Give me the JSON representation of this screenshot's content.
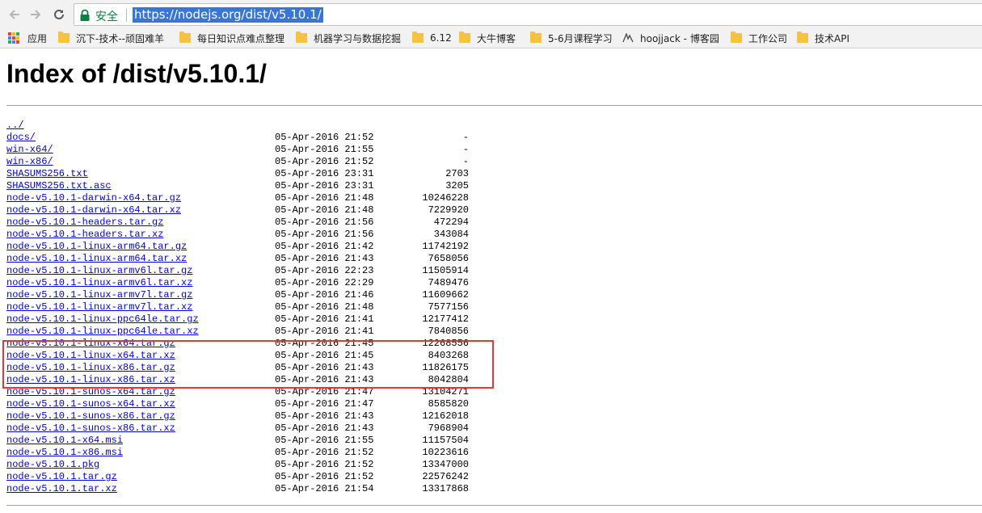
{
  "browser": {
    "secure_label": "安全",
    "url": "https://nodejs.org/dist/v5.10.1/",
    "accent": "#3875d7",
    "secure_color": "#0b8043"
  },
  "bookmarks": [
    {
      "label": "应用",
      "icon": "apps-grid-icon"
    },
    {
      "label": "沉下-技术--顽固难羊",
      "icon": "folder-icon"
    },
    {
      "label": "每日知识点难点整理",
      "icon": "folder-icon"
    },
    {
      "label": "机器学习与数据挖掘",
      "icon": "folder-icon"
    },
    {
      "label": "6.12",
      "icon": "folder-icon"
    },
    {
      "label": "大牛博客",
      "icon": "folder-icon"
    },
    {
      "label": "5-6月课程学习",
      "icon": "folder-icon"
    },
    {
      "label": "hoojjack - 博客园",
      "icon": "cnblogs-icon"
    },
    {
      "label": "工作公司",
      "icon": "folder-icon"
    },
    {
      "label": "技术API",
      "icon": "folder-icon"
    }
  ],
  "page": {
    "title": "Index of /dist/v5.10.1/",
    "link_color": "#0000ee",
    "highlight_color": "#e53935"
  },
  "files": [
    {
      "name": "../",
      "date": "",
      "size": ""
    },
    {
      "name": "docs/",
      "date": "05-Apr-2016 21:52",
      "size": "-"
    },
    {
      "name": "win-x64/",
      "date": "05-Apr-2016 21:55",
      "size": "-"
    },
    {
      "name": "win-x86/",
      "date": "05-Apr-2016 21:52",
      "size": "-"
    },
    {
      "name": "SHASUMS256.txt",
      "date": "05-Apr-2016 23:31",
      "size": "2703"
    },
    {
      "name": "SHASUMS256.txt.asc",
      "date": "05-Apr-2016 23:31",
      "size": "3205"
    },
    {
      "name": "node-v5.10.1-darwin-x64.tar.gz",
      "date": "05-Apr-2016 21:48",
      "size": "10246228"
    },
    {
      "name": "node-v5.10.1-darwin-x64.tar.xz",
      "date": "05-Apr-2016 21:48",
      "size": "7229920"
    },
    {
      "name": "node-v5.10.1-headers.tar.gz",
      "date": "05-Apr-2016 21:56",
      "size": "472294"
    },
    {
      "name": "node-v5.10.1-headers.tar.xz",
      "date": "05-Apr-2016 21:56",
      "size": "343084"
    },
    {
      "name": "node-v5.10.1-linux-arm64.tar.gz",
      "date": "05-Apr-2016 21:42",
      "size": "11742192"
    },
    {
      "name": "node-v5.10.1-linux-arm64.tar.xz",
      "date": "05-Apr-2016 21:43",
      "size": "7658056"
    },
    {
      "name": "node-v5.10.1-linux-armv6l.tar.gz",
      "date": "05-Apr-2016 22:23",
      "size": "11505914"
    },
    {
      "name": "node-v5.10.1-linux-armv6l.tar.xz",
      "date": "05-Apr-2016 22:29",
      "size": "7489476"
    },
    {
      "name": "node-v5.10.1-linux-armv7l.tar.gz",
      "date": "05-Apr-2016 21:46",
      "size": "11609662"
    },
    {
      "name": "node-v5.10.1-linux-armv7l.tar.xz",
      "date": "05-Apr-2016 21:48",
      "size": "7577156"
    },
    {
      "name": "node-v5.10.1-linux-ppc64le.tar.gz",
      "date": "05-Apr-2016 21:41",
      "size": "12177412"
    },
    {
      "name": "node-v5.10.1-linux-ppc64le.tar.xz",
      "date": "05-Apr-2016 21:41",
      "size": "7840856"
    },
    {
      "name": "node-v5.10.1-linux-x64.tar.gz",
      "date": "05-Apr-2016 21:45",
      "size": "12268556"
    },
    {
      "name": "node-v5.10.1-linux-x64.tar.xz",
      "date": "05-Apr-2016 21:45",
      "size": "8403268"
    },
    {
      "name": "node-v5.10.1-linux-x86.tar.gz",
      "date": "05-Apr-2016 21:43",
      "size": "11826175"
    },
    {
      "name": "node-v5.10.1-linux-x86.tar.xz",
      "date": "05-Apr-2016 21:43",
      "size": "8042804"
    },
    {
      "name": "node-v5.10.1-sunos-x64.tar.gz",
      "date": "05-Apr-2016 21:47",
      "size": "13104271"
    },
    {
      "name": "node-v5.10.1-sunos-x64.tar.xz",
      "date": "05-Apr-2016 21:47",
      "size": "8585820"
    },
    {
      "name": "node-v5.10.1-sunos-x86.tar.gz",
      "date": "05-Apr-2016 21:43",
      "size": "12162018"
    },
    {
      "name": "node-v5.10.1-sunos-x86.tar.xz",
      "date": "05-Apr-2016 21:43",
      "size": "7968904"
    },
    {
      "name": "node-v5.10.1-x64.msi",
      "date": "05-Apr-2016 21:55",
      "size": "11157504"
    },
    {
      "name": "node-v5.10.1-x86.msi",
      "date": "05-Apr-2016 21:52",
      "size": "10223616"
    },
    {
      "name": "node-v5.10.1.pkg",
      "date": "05-Apr-2016 21:52",
      "size": "13347000"
    },
    {
      "name": "node-v5.10.1.tar.gz",
      "date": "05-Apr-2016 21:52",
      "size": "22576242"
    },
    {
      "name": "node-v5.10.1.tar.xz",
      "date": "05-Apr-2016 21:54",
      "size": "13317868"
    }
  ]
}
